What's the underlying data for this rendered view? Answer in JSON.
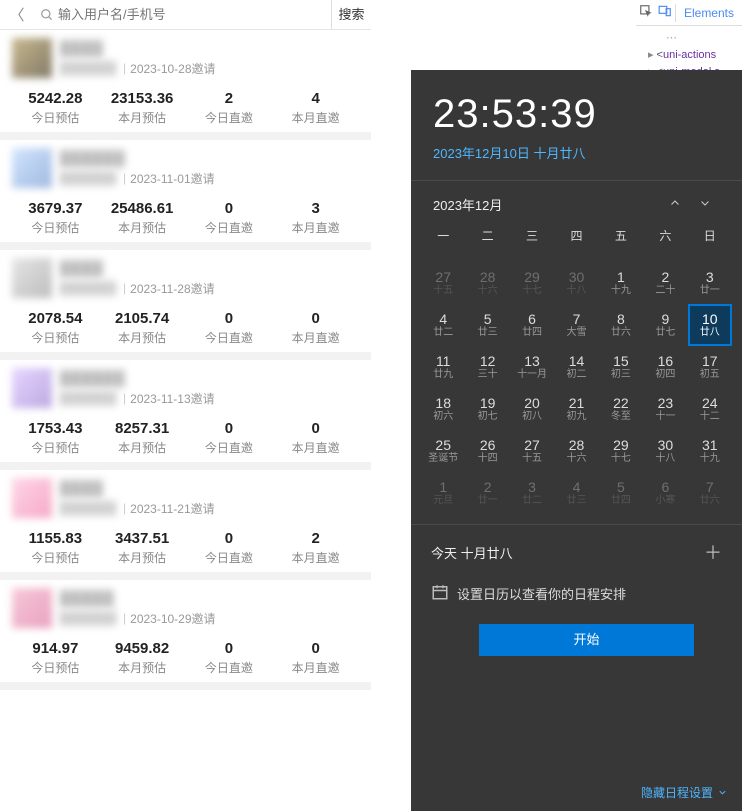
{
  "search": {
    "placeholder": "输入用户名/手机号",
    "btn": "搜索"
  },
  "labels": {
    "stat0": "今日预估",
    "stat1": "本月预估",
    "stat2": "今日直邀",
    "stat3": "本月直邀",
    "invite": "邀请"
  },
  "users": [
    {
      "name": "████",
      "id": "██████",
      "date": "2023-10-28",
      "s": [
        "5242.28",
        "23153.36",
        "2",
        "4"
      ]
    },
    {
      "name": "██████",
      "id": "██████",
      "date": "2023-11-01",
      "s": [
        "3679.37",
        "25486.61",
        "0",
        "3"
      ]
    },
    {
      "name": "████",
      "id": "██████",
      "date": "2023-11-28",
      "s": [
        "2078.54",
        "2105.74",
        "0",
        "0"
      ]
    },
    {
      "name": "██████",
      "id": "██████",
      "date": "2023-11-13",
      "s": [
        "1753.43",
        "8257.31",
        "0",
        "0"
      ]
    },
    {
      "name": "████",
      "id": "██████",
      "date": "2023-11-21",
      "s": [
        "1155.83",
        "3437.51",
        "0",
        "2"
      ]
    },
    {
      "name": "█████",
      "id": "██████",
      "date": "2023-10-29",
      "s": [
        "914.97",
        "9459.82",
        "0",
        "0"
      ]
    }
  ],
  "devtools": {
    "tab": "Elements",
    "node1": "uni-actions",
    "node2": "uni-modal s"
  },
  "clock": {
    "time": "23:53:39",
    "date": "2023年12月10日 十月廿八"
  },
  "cal": {
    "month": "2023年12月",
    "dow": [
      "一",
      "二",
      "三",
      "四",
      "五",
      "六",
      "日"
    ],
    "cells": [
      {
        "n": "27",
        "s": "十五",
        "o": 1
      },
      {
        "n": "28",
        "s": "十六",
        "o": 1
      },
      {
        "n": "29",
        "s": "十七",
        "o": 1
      },
      {
        "n": "30",
        "s": "十八",
        "o": 1
      },
      {
        "n": "1",
        "s": "十九"
      },
      {
        "n": "2",
        "s": "二十"
      },
      {
        "n": "3",
        "s": "廿一"
      },
      {
        "n": "4",
        "s": "廿二"
      },
      {
        "n": "5",
        "s": "廿三"
      },
      {
        "n": "6",
        "s": "廿四"
      },
      {
        "n": "7",
        "s": "大雪"
      },
      {
        "n": "8",
        "s": "廿六"
      },
      {
        "n": "9",
        "s": "廿七"
      },
      {
        "n": "10",
        "s": "廿八",
        "t": 1
      },
      {
        "n": "11",
        "s": "廿九"
      },
      {
        "n": "12",
        "s": "三十"
      },
      {
        "n": "13",
        "s": "十一月"
      },
      {
        "n": "14",
        "s": "初二"
      },
      {
        "n": "15",
        "s": "初三"
      },
      {
        "n": "16",
        "s": "初四"
      },
      {
        "n": "17",
        "s": "初五"
      },
      {
        "n": "18",
        "s": "初六"
      },
      {
        "n": "19",
        "s": "初七"
      },
      {
        "n": "20",
        "s": "初八"
      },
      {
        "n": "21",
        "s": "初九"
      },
      {
        "n": "22",
        "s": "冬至"
      },
      {
        "n": "23",
        "s": "十一"
      },
      {
        "n": "24",
        "s": "十二"
      },
      {
        "n": "25",
        "s": "圣诞节"
      },
      {
        "n": "26",
        "s": "十四"
      },
      {
        "n": "27",
        "s": "十五"
      },
      {
        "n": "28",
        "s": "十六"
      },
      {
        "n": "29",
        "s": "十七"
      },
      {
        "n": "30",
        "s": "十八"
      },
      {
        "n": "31",
        "s": "十九"
      },
      {
        "n": "1",
        "s": "元旦",
        "o": 1
      },
      {
        "n": "2",
        "s": "廿一",
        "o": 1
      },
      {
        "n": "3",
        "s": "廿二",
        "o": 1
      },
      {
        "n": "4",
        "s": "廿三",
        "o": 1
      },
      {
        "n": "5",
        "s": "廿四",
        "o": 1
      },
      {
        "n": "6",
        "s": "小寒",
        "o": 1
      },
      {
        "n": "7",
        "s": "廿六",
        "o": 1
      }
    ]
  },
  "agenda": {
    "today": "今天 十月廿八",
    "setup": "设置日历以查看你的日程安排",
    "start": "开始"
  },
  "hide": "隐藏日程设置"
}
